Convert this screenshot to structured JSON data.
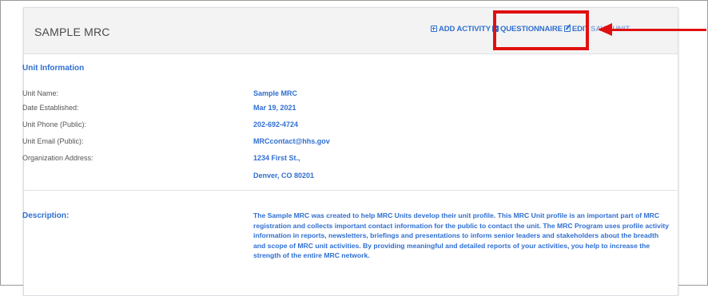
{
  "header": {
    "title": "SAMPLE MRC",
    "actions": {
      "add_activity": "ADD ACTIVITY",
      "questionnaire": "QUESTIONNAIRE",
      "edit": "EDIT",
      "save_unit": "SAVE UNIT"
    }
  },
  "unit_info": {
    "section_title": "Unit Information",
    "rows": [
      {
        "label": "Unit Name:",
        "value": "Sample MRC"
      },
      {
        "label": "Date Established:",
        "value": "Mar 19, 2021"
      },
      {
        "label": "Unit Phone (Public):",
        "value": "202-692-4724"
      },
      {
        "label": "Unit Email (Public):",
        "value": "MRCcontact@hhs.gov"
      },
      {
        "label": "Organization Address:",
        "value": "1234 First St.,"
      },
      {
        "label": "",
        "value": "Denver, CO 80201"
      }
    ]
  },
  "description": {
    "label": "Description:",
    "text": "The Sample MRC was created to help MRC Units develop their unit profile. This MRC Unit profile is an important part of MRC registration and collects important contact information for the public to contact the unit. The MRC Program uses profile activity information in reports, newsletters, briefings and presentations to inform senior leaders and stakeholders about the breadth and scope of MRC unit activities. By providing meaningful and detailed reports of your activities, you help to increase the strength of the entire MRC network."
  },
  "annotation_color": "#e01010",
  "accent_color": "#2f6fd1"
}
